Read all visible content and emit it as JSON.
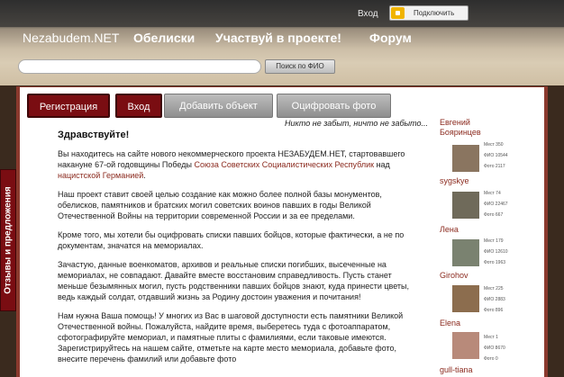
{
  "topbar": {
    "login": "Вход",
    "connect": "Подключить"
  },
  "brand": "Nezabudem.NET",
  "nav": [
    "Обелиски",
    "Участвуй в проекте!",
    "Форум"
  ],
  "search": {
    "button": "Поиск по ФИО"
  },
  "tabs": [
    "Регистрация",
    "Вход",
    "Добавить объект",
    "Оцифровать фото"
  ],
  "motto": "Никто не забыт, ничто не забыто...",
  "feedback": "Отзывы и предложения",
  "content": {
    "title": "Здравствуйте!",
    "p1_a": "Вы находитесь на сайте нового некоммерческого проекта НЕЗАБУДЕМ.НЕТ, стартовавшего накануне 67-ой годовщины Победы ",
    "p1_link1": "Союза Советских Социалистических Республик",
    "p1_b": " над ",
    "p1_link2": "нацистской Германией",
    "p1_c": ".",
    "p2": "Наш проект ставит своей целью создание как можно более полной базы монументов, обелисков, памятников и братских могил советских воинов павших в годы Великой Отечественной Войны на территории современной России и за ее пределами.",
    "p3": "Кроме того, мы хотели бы оцифровать списки павших бойцов, которые фактически, а не по документам, значатся на мемориалах.",
    "p4": "Зачастую, данные военкоматов, архивов и реальные списки погибших, высеченные на мемориалах, не совпадают. Давайте вместе восстановим справедливость. Пусть станет меньше безымянных могил, пусть родственники павших бойцов знают, куда принести цветы, ведь каждый солдат, отдавший жизнь за Родину достоин уважения и почитания!",
    "p5": "Нам нужна Ваша помощь! У многих из Вас в шаговой доступности есть памятники Великой Отечественной войны. Пожалуйста, найдите время, выберетесь туда с фотоаппаратом, сфотографируйте мемориал, и памятные плиты с фамилиями, если таковые имеются. Зарегистрируйтесь на нашем сайте, отметьте на карте место мемориала, добавьте фото, внесите перечень фамилий или добавьте фото"
  },
  "users": [
    {
      "name": "Евгений Бояринцев",
      "stats": [
        "Мест 350",
        "ФИО 10544",
        "Фото 2117"
      ],
      "photo_color": "#8a7560"
    },
    {
      "name": "sygskye",
      "stats": [
        "Мест 74",
        "ФИО 22467",
        "Фото 667"
      ],
      "photo_color": "#6f6a5a"
    },
    {
      "name": "Лена",
      "stats": [
        "Мест 179",
        "ФИО 12610",
        "Фото 1963"
      ],
      "photo_color": "#7a8270"
    },
    {
      "name": "Girohov",
      "stats": [
        "Мест 225",
        "ФИО 2883",
        "Фото 896"
      ],
      "photo_color": "#8c6d4e"
    },
    {
      "name": "Elena",
      "stats": [
        "Мест 1",
        "ФИО 8670",
        "Фото 0"
      ],
      "photo_color": "#b88a7a"
    },
    {
      "name": "gull-tiana",
      "stats": [],
      "photo_color": "#999"
    }
  ]
}
